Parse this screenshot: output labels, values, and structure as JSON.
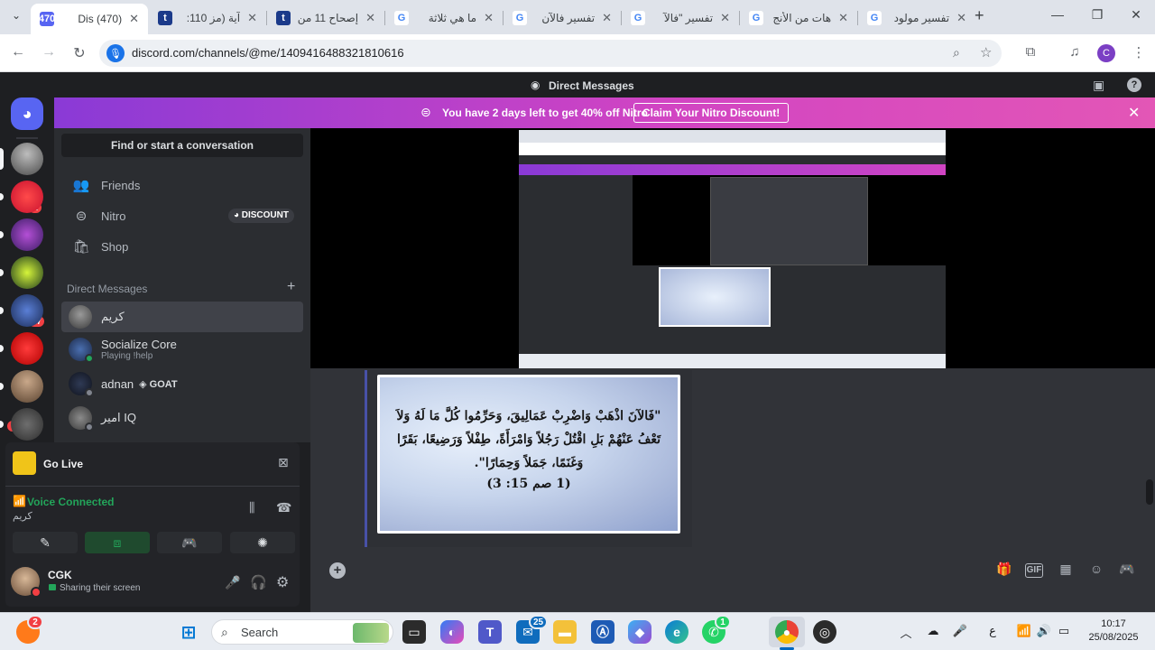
{
  "browser": {
    "tabs": [
      {
        "title": "(470) Dis",
        "favicon_color": "#5865f2",
        "favicon_label": "470",
        "active": true
      },
      {
        "title": "آية (مز 110:",
        "favicon_color": "#1b3a8a",
        "favicon_label": "t"
      },
      {
        "title": "إصحاح 11 من",
        "favicon_color": "#1b3a8a",
        "favicon_label": "t"
      },
      {
        "title": "ما هي ثلاثة",
        "favicon_color": "#ffffff",
        "favicon_label": "G"
      },
      {
        "title": "تفسير فالآن",
        "favicon_color": "#ffffff",
        "favicon_label": "G"
      },
      {
        "title": "تفسير \"فالآ",
        "favicon_color": "#ffffff",
        "favicon_label": "G"
      },
      {
        "title": "هات من الأنج",
        "favicon_color": "#ffffff",
        "favicon_label": "G"
      },
      {
        "title": "تفسير مولود",
        "favicon_color": "#ffffff",
        "favicon_label": "G"
      }
    ],
    "new_tab": "+",
    "window_controls": {
      "minimize": "—",
      "restore": "❐",
      "close": "✕"
    },
    "url": "discord.com/channels/@me/1409416488321810616",
    "profile_initial": "C"
  },
  "discord": {
    "title": "Direct Messages",
    "banner": {
      "text": "You have 2 days left to get 40% off Nitro",
      "button": "Claim Your Nitro Discount!"
    },
    "servers": [
      {
        "badge": ""
      },
      {
        "badge": "1"
      },
      {
        "badge": ""
      },
      {
        "badge": ""
      },
      {
        "badge": "17"
      },
      {
        "badge": ""
      },
      {
        "badge": ""
      },
      {
        "badge": "NEW"
      }
    ],
    "sidebar": {
      "search_placeholder": "Find or start a conversation",
      "nav": [
        {
          "label": "Friends"
        },
        {
          "label": "Nitro",
          "badge": "DISCOUNT"
        },
        {
          "label": "Shop"
        }
      ],
      "dm_header": "Direct Messages",
      "dms": [
        {
          "name": "كريم",
          "sub": ""
        },
        {
          "name": "Socialize Core",
          "sub": "Playing !help"
        },
        {
          "name": "adnan",
          "sub": "",
          "tag": "GOAT"
        },
        {
          "name": "امير IQ",
          "sub": ""
        }
      ]
    },
    "go_live": "Go Live",
    "voice": {
      "status": "Voice Connected",
      "channel": "كريم"
    },
    "user": {
      "name": "CGK",
      "status": "Sharing their screen"
    },
    "verse": {
      "text": "\"فَالآنَ اذْهَبْ وَاضْرِبْ عَمَالِيقَ، وَحَرِّمُوا كُلَّ مَا لَهُ وَلاَ تَعْفُ عَنْهُمْ بَلِ اقْتُلْ رَجُلاً وَامْرَأَةً، طِفْلاً وَرَضِيعًا، بَقَرًا وَغَنَمًا، جَمَلاً وَحِمَارًا\".",
      "ref": "(1 صم 15: 3)"
    }
  },
  "taskbar": {
    "search_label": "Search",
    "outlook_badge": "25",
    "whatsapp_badge": "1",
    "notif_badge": "2",
    "lang": "ع",
    "time": "10:17",
    "date": "25/08/2025"
  }
}
